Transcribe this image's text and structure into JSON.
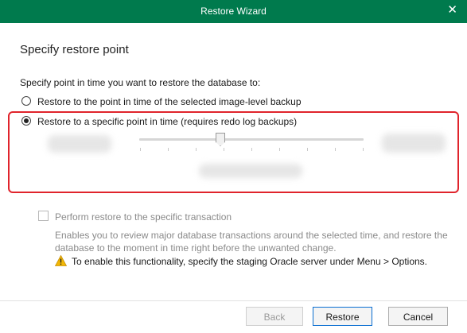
{
  "window": {
    "title": "Restore Wizard",
    "close_glyph": "✕"
  },
  "header": {
    "title": "Specify restore point"
  },
  "main": {
    "prompt": "Specify point in time you want to restore the database to:",
    "options": [
      {
        "label": "Restore to the point in time of the selected image-level backup",
        "selected": false
      },
      {
        "label": "Restore to a specific point in time (requires redo log backups)",
        "selected": true
      }
    ],
    "transaction": {
      "label": "Perform restore to the specific transaction",
      "checked": false,
      "enabled": false,
      "description": "Enables you to review major database transactions around the selected time, and restore the database to the moment in time right before the unwanted change.",
      "warning": "To enable this functionality, specify the staging Oracle server under Menu > Options."
    }
  },
  "buttons": {
    "back": "Back",
    "restore": "Restore",
    "cancel": "Cancel"
  },
  "colors": {
    "titlebar": "#007a4d",
    "highlight": "#e0242c",
    "warning": "#f2b705"
  },
  "icons": {
    "close": "close-icon",
    "warning": "warning-icon"
  }
}
